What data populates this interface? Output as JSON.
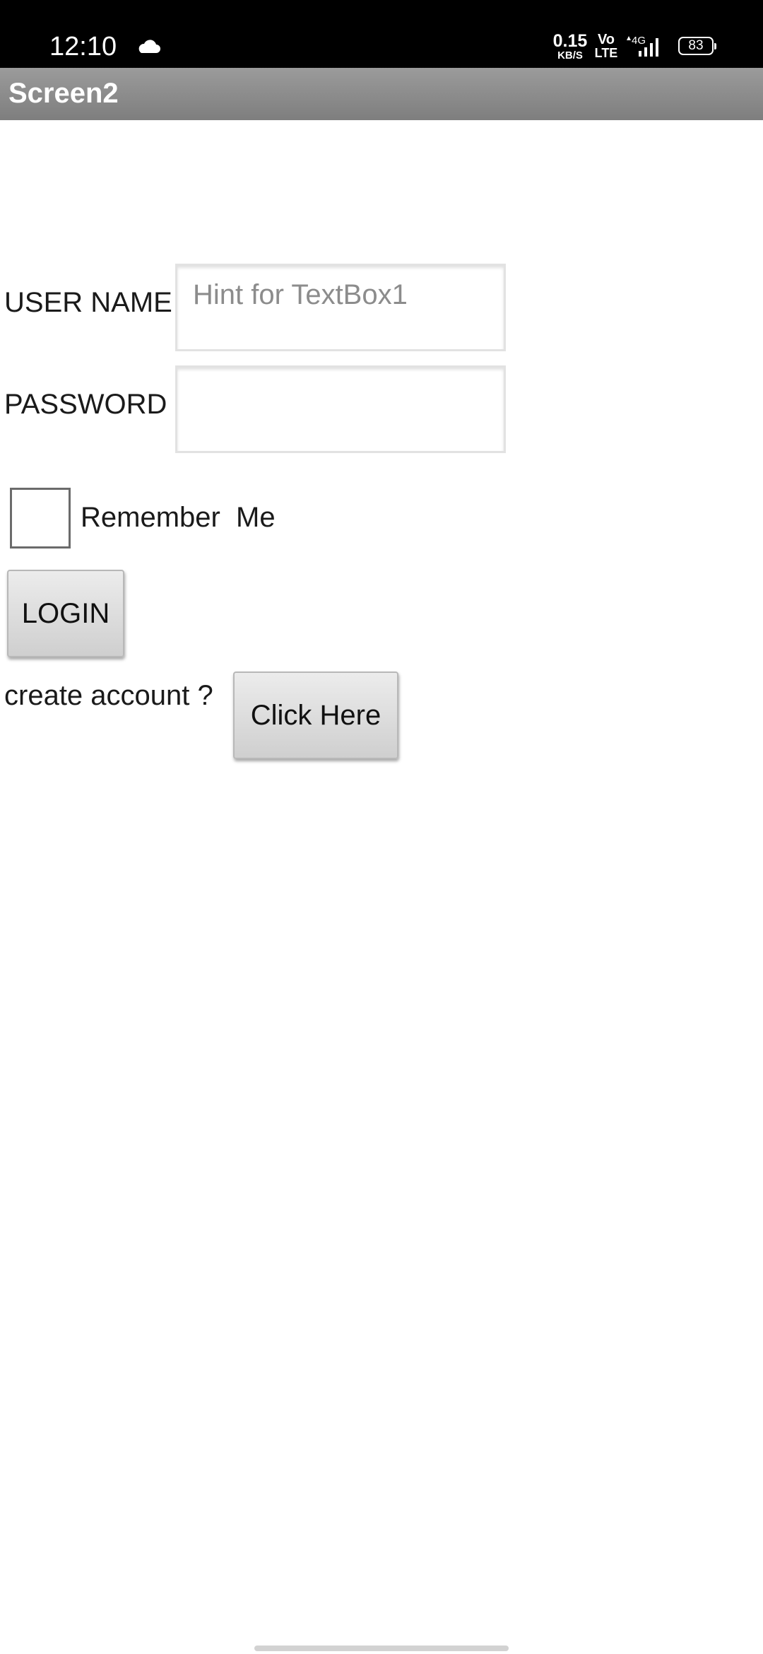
{
  "status_bar": {
    "time": "12:10",
    "cloud_icon": "cloud-icon",
    "net_speed_value": "0.15",
    "net_speed_unit": "KB/S",
    "volte_top": "Vo",
    "volte_bottom": "LTE",
    "network_type": "4G",
    "signal_icon": "signal-icon",
    "battery_level": "83"
  },
  "app_bar": {
    "title": "Screen2"
  },
  "form": {
    "username_label": "USER NAME",
    "username_placeholder": "Hint for TextBox1",
    "username_value": "",
    "password_label": "PASSWORD",
    "password_value": "",
    "remember_label": "Remember  Me",
    "remember_checked": false,
    "login_button": "LOGIN",
    "create_account_label": "create account ?",
    "click_here_button": "Click Here"
  },
  "colors": {
    "status_bar_bg": "#000000",
    "title_bar_bg": "#8a8a8a",
    "page_bg": "#ffffff"
  }
}
